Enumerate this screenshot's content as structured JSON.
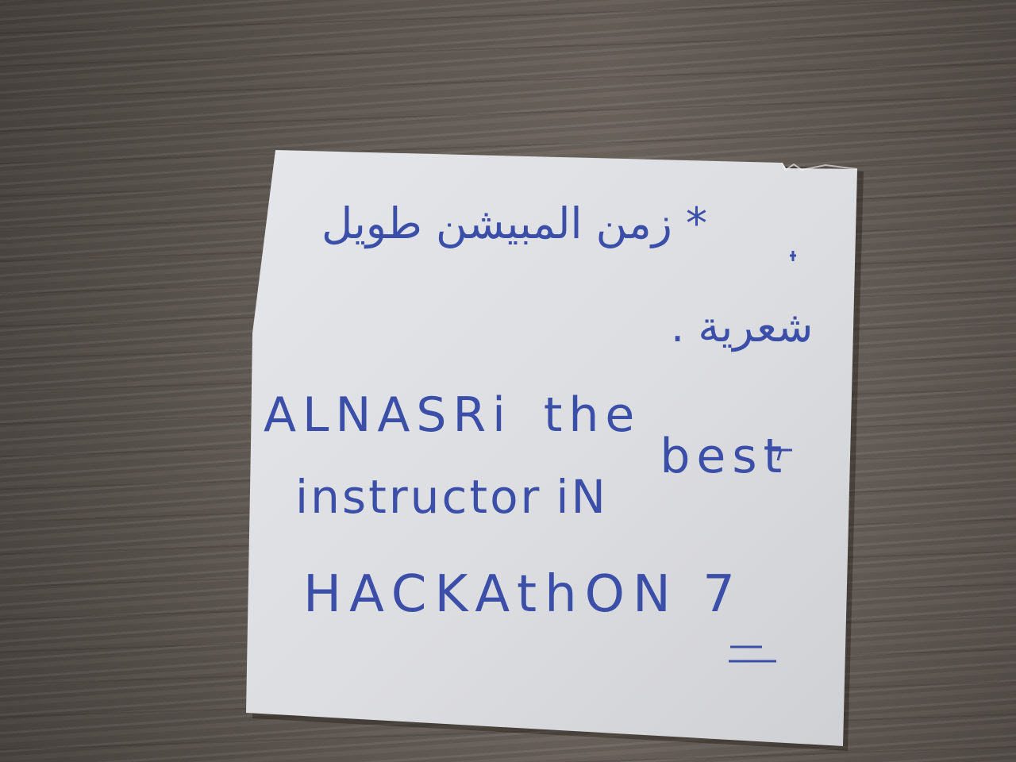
{
  "note": {
    "arabic_line_1": "* زمن المبيشن طويل",
    "arabic_line_2": "شعرية .",
    "english_line_1_word_1": "ALNASRi",
    "english_line_1_word_2": "the",
    "english_line_1_word_3": "best",
    "english_line_2_word_1": "instructor",
    "english_line_2_word_2": "iN",
    "english_line_3": "HACKAthON 7"
  },
  "colors": {
    "ink": "#3c4fa8",
    "paper": "#dfe0e2",
    "table": "#615850"
  }
}
